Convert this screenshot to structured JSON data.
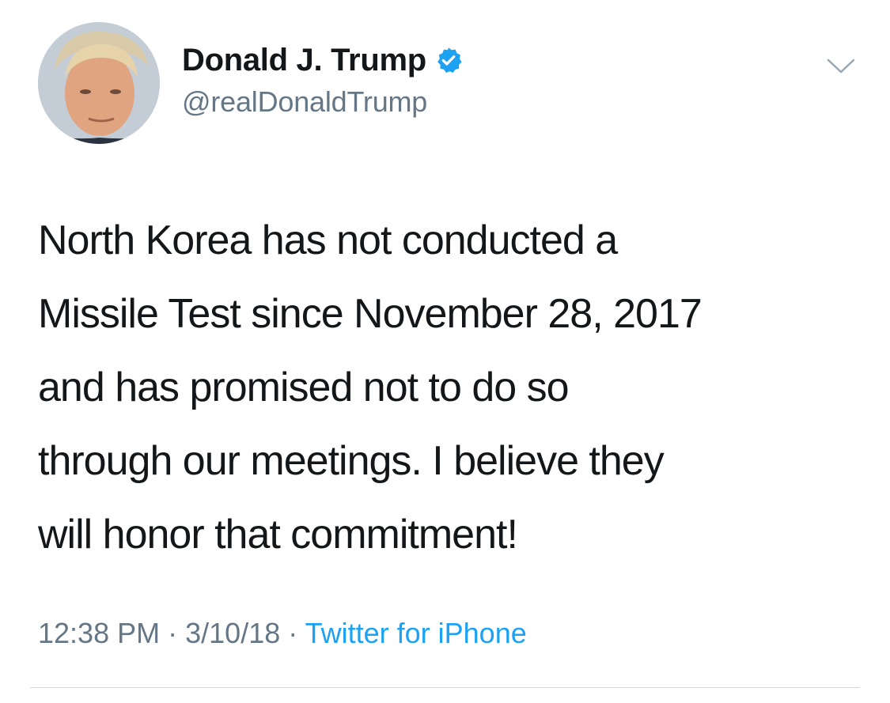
{
  "user": {
    "display_name": "Donald J. Trump",
    "handle": "@realDonaldTrump",
    "verified": true,
    "avatar_icon": "profile-photo"
  },
  "tweet": {
    "lines": [
      "North Korea has not conducted a",
      "Missile Test since November 28, 2017",
      "and has promised not to do so",
      "through our meetings. I believe they",
      "will honor that commitment!"
    ]
  },
  "meta": {
    "time": "12:38 PM",
    "separator": "·",
    "date": "3/10/18",
    "source": "Twitter for iPhone"
  },
  "colors": {
    "text": "#14171a",
    "secondary": "#657786",
    "link": "#1da1f2",
    "verified": "#1da1f2"
  },
  "icons": {
    "more": "chevron-down-icon",
    "verified": "verified-badge-icon"
  }
}
